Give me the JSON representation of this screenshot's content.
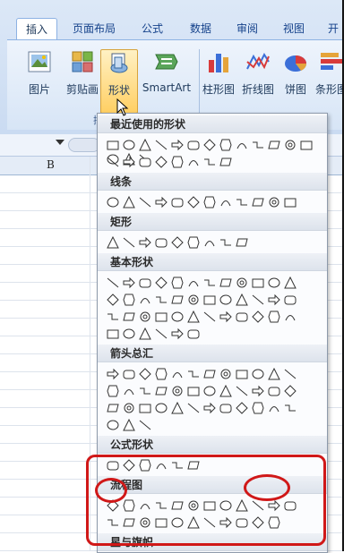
{
  "ribbon": {
    "tabs": [
      {
        "label": "插入",
        "active": true
      },
      {
        "label": "页面布局"
      },
      {
        "label": "公式"
      },
      {
        "label": "数据"
      },
      {
        "label": "审阅"
      },
      {
        "label": "视图"
      },
      {
        "label": "开"
      }
    ],
    "buttons": [
      {
        "label": "图片",
        "icon": "picture-icon"
      },
      {
        "label": "剪贴画",
        "icon": "clipart-icon"
      },
      {
        "label": "形状",
        "icon": "shapes-icon",
        "hot": true
      },
      {
        "label": "SmartArt",
        "icon": "smartart-icon"
      },
      {
        "label": "柱形图",
        "icon": "column-chart-icon"
      },
      {
        "label": "折线图",
        "icon": "line-chart-icon"
      },
      {
        "label": "饼图",
        "icon": "pie-chart-icon"
      },
      {
        "label": "条形图",
        "icon": "bar-chart-icon"
      }
    ],
    "group_label_fragment": "插"
  },
  "sheet": {
    "column_label": "B"
  },
  "shapes_menu": {
    "sections": [
      {
        "title": "最近使用的形状",
        "rows": [
          16,
          8
        ]
      },
      {
        "title": "线条",
        "rows": [
          12
        ]
      },
      {
        "title": "矩形",
        "rows": [
          9
        ]
      },
      {
        "title": "基本形状",
        "rows": [
          12,
          12,
          12,
          6
        ]
      },
      {
        "title": "箭头总汇",
        "rows": [
          12,
          12,
          12,
          3
        ]
      },
      {
        "title": "公式形状",
        "rows": [
          6
        ]
      },
      {
        "title": "流程图",
        "rows": [
          12,
          11
        ]
      },
      {
        "title": "星与旗帜",
        "rows": []
      }
    ]
  },
  "colors": {
    "highlight": "#d01818",
    "ribbon_text": "#1e395b",
    "hot_button": "#ffcf63"
  }
}
